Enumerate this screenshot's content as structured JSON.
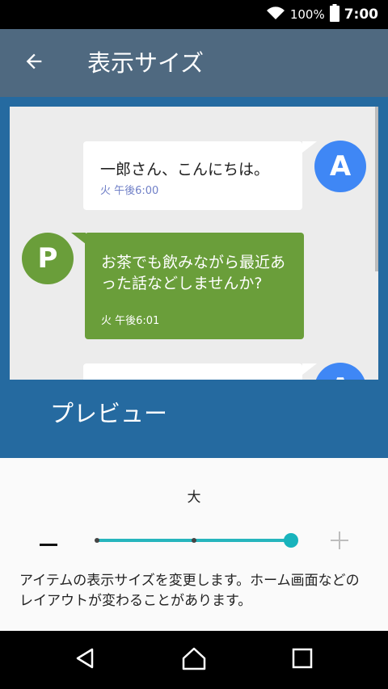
{
  "status_bar": {
    "battery": "100%",
    "time": "7:00"
  },
  "app_bar": {
    "title": "表示サイズ"
  },
  "preview": {
    "messages": [
      {
        "avatar": "A",
        "text": "一郎さん、こんにちは。",
        "time": "火 午後6:00"
      },
      {
        "avatar": "P",
        "text": "お茶でも飲みながら最近あった話などしませんか?",
        "time": "火 午後6:01"
      },
      {
        "avatar": "A"
      }
    ],
    "label": "プレビュー"
  },
  "settings": {
    "size_label": "大",
    "slider": {
      "steps": 3,
      "selected_index": 2
    },
    "description": "アイテムの表示サイズを変更します。ホーム画面などのレイアウトが変わることがあります。"
  },
  "colors": {
    "app_bar": "#4f6980",
    "preview_bg": "#256aa0",
    "avatar_a": "#3f87f5",
    "avatar_p": "#6a9e3a",
    "slider_accent": "#18b3bc"
  }
}
